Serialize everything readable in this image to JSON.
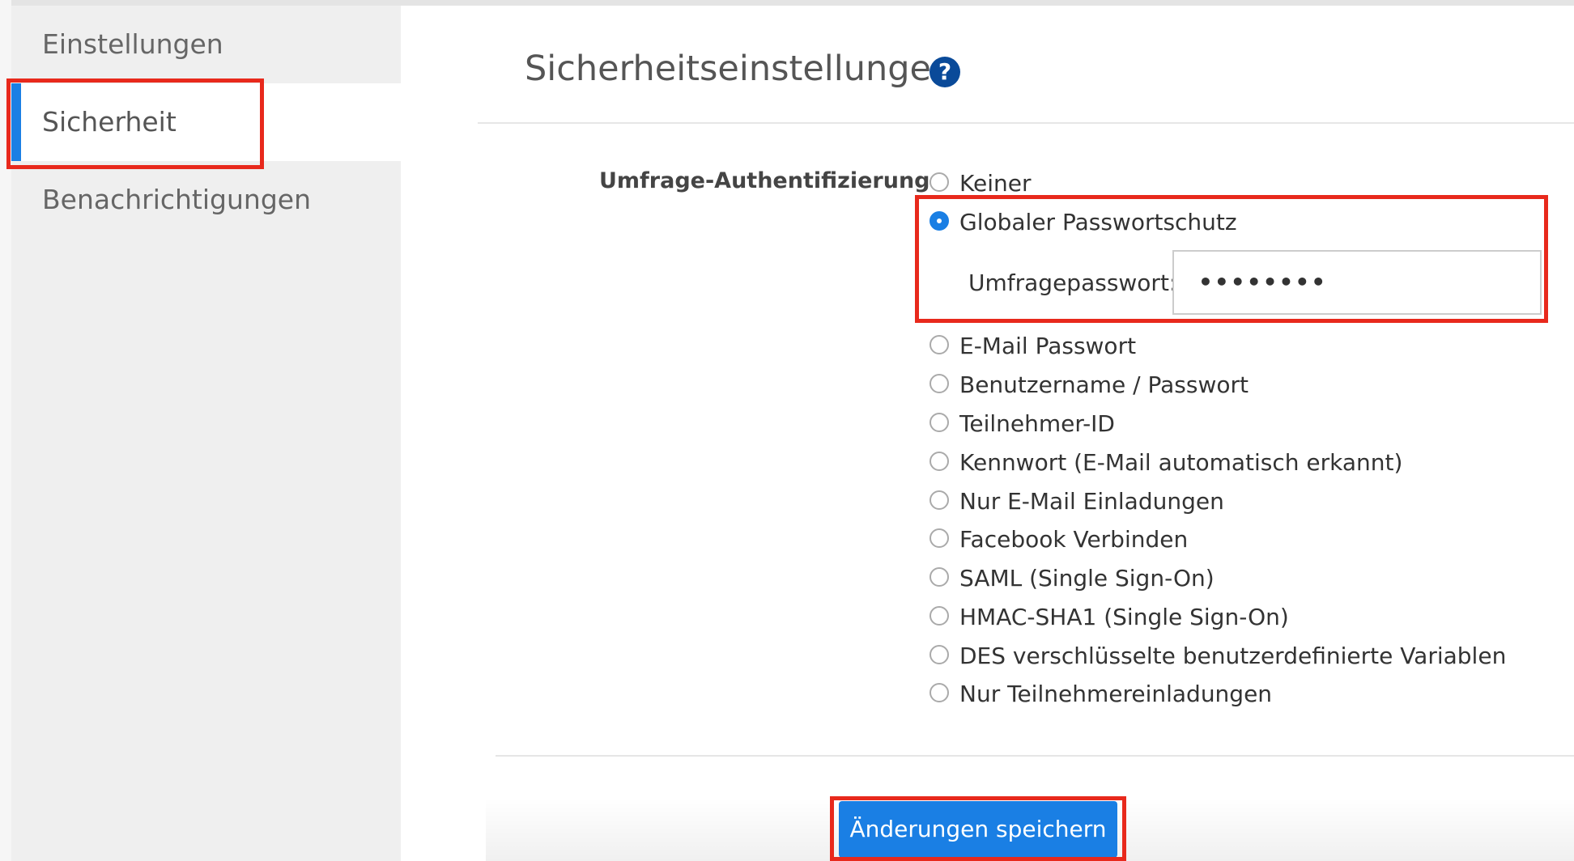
{
  "sidebar": {
    "items": [
      {
        "label": "Einstellungen"
      },
      {
        "label": "Sicherheit"
      },
      {
        "label": "Benachrichtigungen"
      }
    ]
  },
  "header": {
    "title": "Sicherheitseinstellungen",
    "help_icon": "?"
  },
  "form": {
    "auth_label": "Umfrage-Authentifizierung:",
    "options": [
      {
        "label": "Keiner",
        "checked": false
      },
      {
        "label": "Globaler Passwortschutz",
        "checked": true
      },
      {
        "label": "E-Mail Passwort",
        "checked": false
      },
      {
        "label": "Benutzername / Passwort",
        "checked": false
      },
      {
        "label": "Teilnehmer-ID",
        "checked": false
      },
      {
        "label": "Kennwort (E-Mail automatisch erkannt)",
        "checked": false
      },
      {
        "label": "Nur E-Mail Einladungen",
        "checked": false
      },
      {
        "label": "Facebook Verbinden",
        "checked": false
      },
      {
        "label": "SAML (Single Sign-On)",
        "checked": false
      },
      {
        "label": "HMAC-SHA1 (Single Sign-On)",
        "checked": false
      },
      {
        "label": "DES verschlüsselte benutzerdefinierte Variablen",
        "checked": false
      },
      {
        "label": "Nur Teilnehmereinladungen",
        "checked": false
      }
    ],
    "password_label": "Umfragepasswort:",
    "password_value": "••••••••"
  },
  "footer": {
    "save_label": "Änderungen speichern"
  },
  "colors": {
    "accent": "#1a7fe4",
    "highlight": "#e8291c",
    "help_icon_bg": "#0a4a99"
  }
}
